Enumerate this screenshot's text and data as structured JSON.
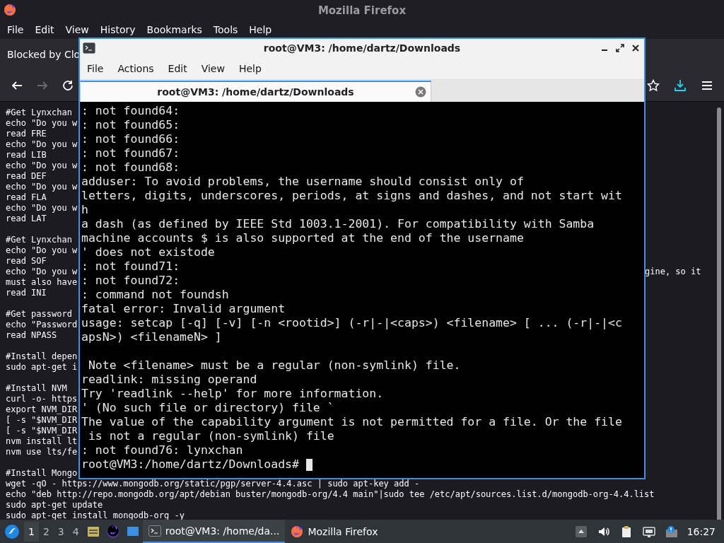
{
  "firefox": {
    "title": "Mozilla Firefox",
    "menu": [
      "File",
      "Edit",
      "View",
      "History",
      "Bookmarks",
      "Tools",
      "Help"
    ],
    "notification": "Blocked by Clo",
    "toolbar": [
      {
        "kind": "back",
        "disabled": false
      },
      {
        "kind": "forward",
        "disabled": true
      },
      {
        "kind": "reload",
        "disabled": false
      },
      {
        "kind": "star",
        "disabled": false
      },
      {
        "kind": "download",
        "disabled": false
      },
      {
        "kind": "menu",
        "disabled": false
      }
    ],
    "page_blocks": [
      [
        "#Get Lynxchan",
        "echo \"Do you w",
        "read FRE",
        "echo \"Do you w",
        "read LIB",
        "echo \"Do you w",
        "read DEF",
        "echo \"Do you w",
        "read FLA",
        "echo \"Do you w",
        "read LAT"
      ],
      [
        "#Get Lynxchan",
        "echo \"Do you w",
        "read SOF",
        {
          "text": "echo \"Do you w",
          "tail": "gine, so it"
        },
        "must also have",
        "read INI"
      ],
      [
        "#Get password",
        "echo \"Password",
        "read NPASS"
      ],
      [
        "#Install depen",
        "sudo apt-get i"
      ],
      [
        "#Install NVM",
        "curl -o- https",
        "export NVM_DIR",
        "[ -s \"$NVM_DIR",
        "[ -s \"$NVM_DIR",
        "nvm install lt",
        "nvm use lts/fe"
      ],
      [
        "#Install Mongo",
        "wget -qO - https://www.mongodb.org/static/pgp/server-4.4.asc | sudo apt-key add -",
        "echo \"deb http://repo.mongodb.org/apt/debian buster/mongodb-org/4.4 main\"|sudo tee /etc/apt/sources.list.d/mongodb-org-4.4.list",
        "sudo apt-get update",
        "sudo apt-get install mongodb-org -y"
      ]
    ]
  },
  "terminal": {
    "title": "root@VM3: /home/dartz/Downloads",
    "menu": [
      "File",
      "Actions",
      "Edit",
      "View",
      "Help"
    ],
    "tabs": [
      {
        "title": "root@VM3: /home/dartz/Downloads",
        "selected": true
      }
    ],
    "output_blocks": [
      [
        ": not found64:",
        ": not found65:",
        ": not found66:",
        ": not found67:",
        ": not found68:",
        "adduser: To avoid problems, the username should consist only of",
        "letters, digits, underscores, periods, at signs and dashes, and not start wit",
        "h",
        "a dash (as defined by IEEE Std 1003.1-2001). For compatibility with Samba",
        "machine accounts $ is also supported at the end of the username",
        "' does not existode",
        ": not found71:",
        ": not found72:",
        ": command not foundsh",
        "fatal error: Invalid argument",
        "usage: setcap [-q] [-v] [-n <rootid>] (-r|-|<caps>) <filename> [ ... (-r|-|<c",
        "apsN>) <filenameN> ]"
      ],
      [
        " Note <filename> must be a regular (non-symlink) file.",
        "readlink: missing operand",
        "Try 'readlink --help' for more information.",
        "' (No such file or directory) file `",
        "The value of the capability argument is not permitted for a file. Or the file",
        " is not a regular (non-symlink) file",
        ": not found76: lynxchan"
      ]
    ],
    "prompt": "root@VM3:/home/dartz/Downloads# "
  },
  "taskbar": {
    "workspaces": [
      {
        "label": "1",
        "selected": true
      },
      {
        "label": "2",
        "selected": false
      },
      {
        "label": "3",
        "selected": false
      },
      {
        "label": "4",
        "selected": false
      }
    ],
    "launchers": [
      {
        "kind": "files"
      },
      {
        "kind": "browser"
      },
      {
        "kind": "desktop"
      }
    ],
    "tasks": [
      {
        "kind": "terminal",
        "label": "root@VM3: /home/da...",
        "selected": true
      },
      {
        "kind": "browser",
        "label": "Mozilla Firefox",
        "selected": false
      }
    ],
    "tray": [
      {
        "kind": "up"
      },
      {
        "kind": "volume"
      },
      {
        "kind": "clipboard"
      },
      {
        "kind": "network"
      },
      {
        "kind": "notice"
      }
    ],
    "clock": "16:27"
  }
}
